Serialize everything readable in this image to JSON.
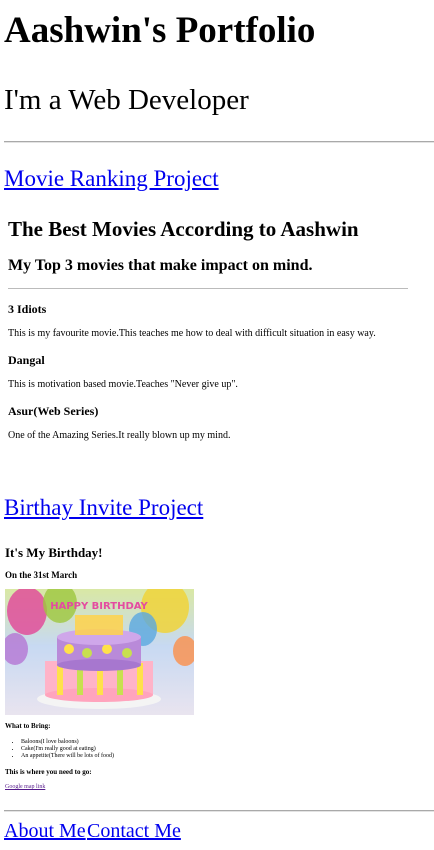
{
  "header": {
    "title": "Aashwin's Portfolio",
    "subtitle": "I'm a Web Developer"
  },
  "projects": {
    "movie": {
      "link_label": "Movie Ranking Project",
      "preview": {
        "title": "The Best Movies According to Aashwin",
        "subtitle": "My Top 3 movies that make impact on mind.",
        "movies": [
          {
            "name": "3 Idiots",
            "description": "This is my favourite movie.This teaches me how to deal with difficult situation in easy way."
          },
          {
            "name": "Dangal",
            "description": "This is motivation based movie.Teaches \"Never give up\"."
          },
          {
            "name": "Asur(Web Series)",
            "description": "One of the Amazing Series.It really blown up my mind."
          }
        ]
      }
    },
    "birthday": {
      "link_label": "Birthay Invite Project",
      "preview": {
        "title": "It's My Birthday!",
        "date": "On the 31st March",
        "cake_text": "HAPPY BIRTHDAY",
        "bring_heading": "What to Bring:",
        "items": [
          "Baloons(I love baloons)",
          "Cake(I'm really good at eating)",
          "An appetite(There will be lots of food)"
        ],
        "where_heading": "This is where you need to go:",
        "map_link": "Google map link"
      }
    }
  },
  "footer": {
    "about_label": "About Me",
    "contact_label": "Contact Me"
  }
}
